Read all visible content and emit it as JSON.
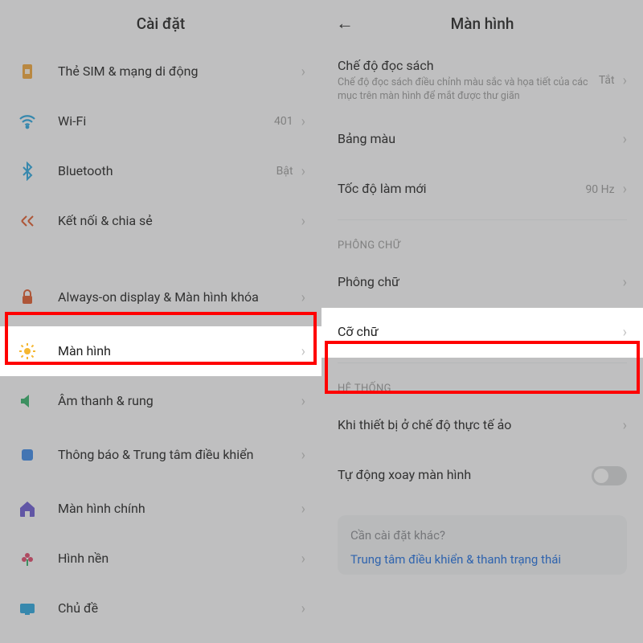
{
  "left": {
    "title": "Cài đặt",
    "items": {
      "sim": {
        "label": "Thẻ SIM & mạng di động"
      },
      "wifi": {
        "label": "Wi-Fi",
        "value": "401"
      },
      "bt": {
        "label": "Bluetooth",
        "value": "Bật"
      },
      "share": {
        "label": "Kết nối & chia sẻ"
      },
      "aod": {
        "label": "Always-on display & Màn hình khóa"
      },
      "display": {
        "label": "Màn hình"
      },
      "sound": {
        "label": "Âm thanh & rung"
      },
      "notif": {
        "label": "Thông báo & Trung tâm điều khiển"
      },
      "home": {
        "label": "Màn hình chính"
      },
      "wall": {
        "label": "Hình nền"
      },
      "theme": {
        "label": "Chủ đề"
      }
    }
  },
  "right": {
    "title": "Màn hình",
    "reading": {
      "label": "Chế độ đọc sách",
      "desc": "Chế độ đọc sách điều chỉnh màu sắc và họa tiết của các mục trên màn hình để mắt được thư giãn",
      "value": "Tắt"
    },
    "palette": {
      "label": "Bảng màu"
    },
    "refresh": {
      "label": "Tốc độ làm mới",
      "value": "90 Hz"
    },
    "section_font": "PHÔNG CHỮ",
    "font": {
      "label": "Phông chữ"
    },
    "size": {
      "label": "Cỡ chữ"
    },
    "section_sys": "HỆ THỐNG",
    "vr": {
      "label": "Khi thiết bị ở chế độ thực tế ảo"
    },
    "rotate": {
      "label": "Tự động xoay màn hình"
    },
    "card": {
      "title": "Cần cài đặt khác?",
      "link": "Trung tâm điều khiển & thanh trạng thái"
    }
  }
}
